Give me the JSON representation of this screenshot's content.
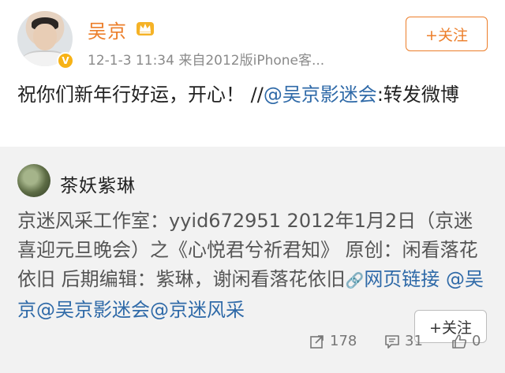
{
  "post": {
    "username": "吴京",
    "verified_badge": "V",
    "meta": "12-1-3 11:34  来自2012版iPhone客...",
    "follow_label": "+关注",
    "text_prefix": "祝你们新年行好运，开心！ //",
    "mention": "@吴京影迷会",
    "text_suffix": ":转发微博",
    "icons": {
      "crown": "crown-icon",
      "verified": "verified-badge-icon"
    }
  },
  "repost": {
    "username": "茶妖紫琳",
    "follow_label": "+关注",
    "text": "京迷风采工作室：yyid672951 2012年1月2日（京迷喜迎元旦晚会）之《心悦君兮祈君知》 原创：闲看落花依旧 后期编辑：紫琳，谢闲看落花依旧",
    "link_label": "网页链接",
    "mentions": " @吴京@吴京影迷会@京迷风采",
    "share_count": "178",
    "comment_count": "31",
    "like_count": "0"
  },
  "colors": {
    "accent_orange": "#ec7e2a",
    "link_blue": "#2f6aa8",
    "repost_bg": "#f2f2f2"
  }
}
